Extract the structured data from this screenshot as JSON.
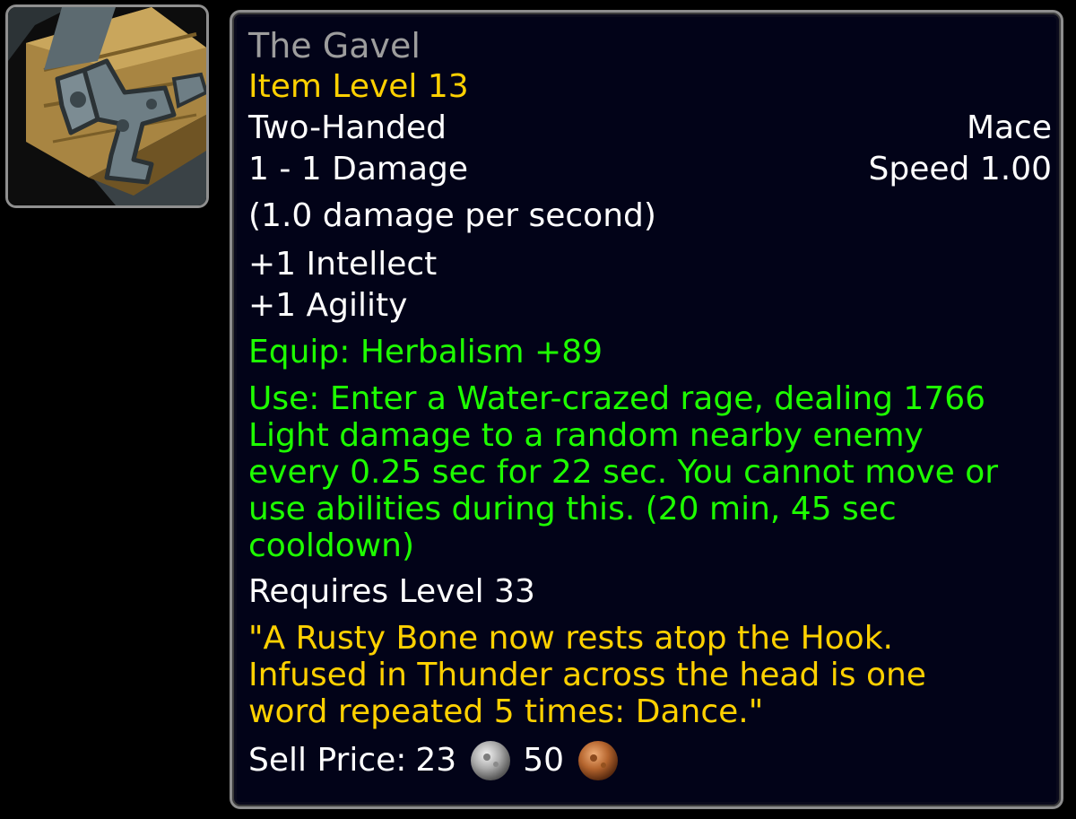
{
  "item": {
    "name": "The Gavel",
    "item_level": "Item Level 13",
    "slot": "Two-Handed",
    "type": "Mace",
    "damage": "1 - 1 Damage",
    "speed": "Speed 1.00",
    "dps": "(1.0 damage per second)",
    "stats": [
      "+1 Intellect",
      "+1 Agility"
    ],
    "equip": "Equip: Herbalism +89",
    "use_lines": [
      "Use: Enter a Water-crazed rage, dealing 1766",
      "Light damage to a random nearby enemy",
      "every 0.25 sec for 22 sec. You cannot move or",
      "use abilities during this. (20 min, 45 sec",
      "cooldown)"
    ],
    "requires": "Requires Level 33",
    "flavor_lines": [
      "\"A Rusty Bone now rests atop the Hook.",
      "Infused in Thunder across the head is one",
      "word repeated 5 times: Dance.\""
    ],
    "sell": {
      "label": "Sell Price:",
      "silver": "23",
      "copper": "50"
    },
    "icon": "mace-head-icon"
  },
  "colors": {
    "name_poor": "#9d9d9d",
    "gold": "#ffd100",
    "green": "#1eff00",
    "white": "#ffffff",
    "tooltip_bg": "#020318"
  }
}
